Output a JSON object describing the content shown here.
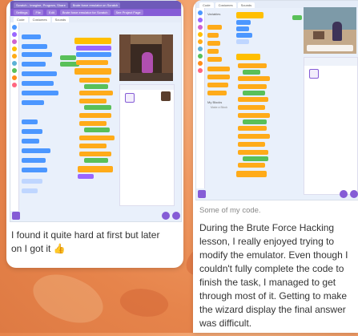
{
  "left_post": {
    "screenshot": {
      "browser_tabs": [
        "Scratch - Imagine, Program, Share",
        "Brute force emulator on Scratch"
      ],
      "menu": [
        "Settings",
        "File",
        "Edit",
        "Brute force emulator for Scratch",
        "See Project Page"
      ],
      "editor_tabs": [
        "Code",
        "Costumes",
        "Sounds"
      ]
    },
    "caption": "I found it quite hard at first but later on I got it",
    "caption_emoji": "👍"
  },
  "right_post": {
    "screenshot": {
      "editor_tabs": [
        "Code",
        "Costumes",
        "Sounds"
      ],
      "sidebar_labels": [
        "Variables",
        "Make a Variable",
        "My Blocks",
        "Make a Block"
      ]
    },
    "small_caption": "Some of my code.",
    "caption": "During the Brute Force Hacking lesson, I really enjoyed trying to modify the emulator. Even though I couldn't fully complete the code to finish the task, I managed to get through most of it. Getting to make the wizard display the final answer was difficult."
  },
  "colors": {
    "scratch_purple": "#855cd6",
    "motion_blue": "#4c97ff",
    "control_orange": "#ffab19",
    "operator_green": "#59c059"
  }
}
